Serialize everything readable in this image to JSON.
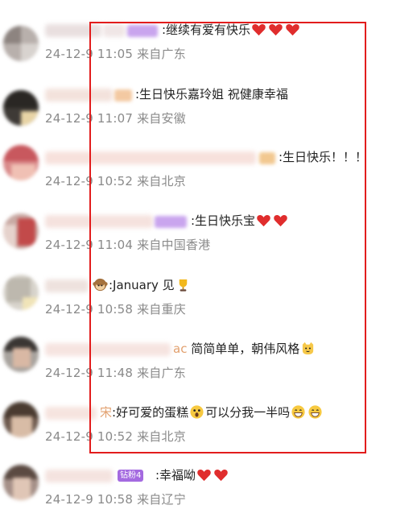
{
  "comments": [
    {
      "text": ":继续有爱有快乐",
      "time": "24-12-9 11:05",
      "location": "来自广东",
      "emojis_after": [
        "heart-icon",
        "heart-icon",
        "heart-icon"
      ]
    },
    {
      "text": ":生日快乐嘉玲姐 祝健康幸福",
      "time": "24-12-9 11:07",
      "location": "来自安徽"
    },
    {
      "text": ":生日快乐！！！",
      "time": "24-12-9 10:52",
      "location": "来自北京"
    },
    {
      "text": ":生日快乐宝",
      "time": "24-12-9 11:04",
      "location": "来自中国香港",
      "emojis_after": [
        "heart-icon",
        "heart-icon"
      ]
    },
    {
      "text_before": ":January 见",
      "time": "24-12-9 10:58",
      "location": "来自重庆",
      "emojis_before": [
        "monkey-icon"
      ],
      "emojis_after": [
        "trophy-icon"
      ]
    },
    {
      "name_tail": "ac",
      "text": " 简简单单，朝伟风格",
      "time": "24-12-9 11:48",
      "location": "来自广东",
      "emojis_after": [
        "cat-face-icon"
      ]
    },
    {
      "name_tail": "宋",
      "text_a": ":好可爱的蛋糕",
      "text_b": "可以分我一半吗",
      "time": "24-12-9 10:52",
      "location": "来自北京",
      "emojis_mid": [
        "astonished-face-icon"
      ],
      "emojis_after": [
        "grinning-face-icon",
        "grinning-face-icon"
      ]
    },
    {
      "badge": "钻粉4",
      "text": ":幸福呦",
      "time": "24-12-9 10:58",
      "location": "来自辽宁",
      "emojis_after": [
        "heart-icon",
        "heart-icon"
      ]
    }
  ],
  "colors": {
    "highlight": "#e21c1c",
    "meta_text": "#8a8a8a",
    "body_text": "#222222",
    "badge": "#a46ae0"
  }
}
